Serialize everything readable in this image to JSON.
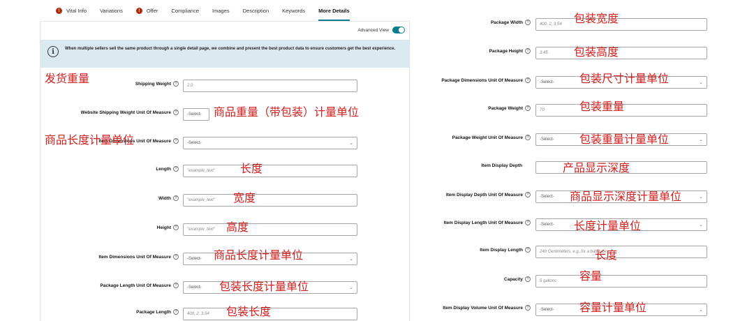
{
  "tabs": [
    {
      "label": "Vital Info",
      "error": true
    },
    {
      "label": "Variations",
      "error": false
    },
    {
      "label": "Offer",
      "error": true
    },
    {
      "label": "Compliance",
      "error": false
    },
    {
      "label": "Images",
      "error": false
    },
    {
      "label": "Description",
      "error": false
    },
    {
      "label": "Keywords",
      "error": false
    },
    {
      "label": "More Details",
      "error": false,
      "active": true
    }
  ],
  "error_badge": "!",
  "advanced_view": {
    "label": "Advanced View",
    "enabled": true
  },
  "info_banner": {
    "icon": "info-icon",
    "text": "When multiple sellers sell the same product through a single detail page, we combine and present the best product data to ensure customers get the best experience."
  },
  "help_glyph": "?",
  "left_fields": [
    {
      "label": "Shipping Weight",
      "placeholder": "2.0",
      "type": "input",
      "annotation": "商品重量(带包装)计量单位"
    },
    {
      "label": "Website Shipping Weight Unit Of Measure",
      "placeholder": "-Select-",
      "type": "select",
      "annotation": "商品重量（带包装）计量单位"
    },
    {
      "label": "Item Dimensions Unit Of Measure",
      "placeholder": "-Select-",
      "type": "select",
      "annotation": "商品长度计量单位"
    },
    {
      "label": "Length",
      "placeholder": "\"example_text\"",
      "type": "input",
      "annotation": "长度"
    },
    {
      "label": "Width",
      "placeholder": "\"example_text\"",
      "type": "input",
      "annotation": "宽度"
    },
    {
      "label": "Height",
      "placeholder": "\"example_text\"",
      "type": "input",
      "annotation": "高度"
    },
    {
      "label": "Item Dimensions Unit Of Measure",
      "placeholder": "-Select-",
      "type": "select",
      "annotation": "商品长度计量单位"
    },
    {
      "label": "Package Length Unit Of Measure",
      "placeholder": "-Select-",
      "type": "select",
      "annotation": "包装长度计量单位"
    },
    {
      "label": "Package Length",
      "placeholder": "400, 2, 3.54",
      "type": "input",
      "annotation": "包装长度"
    }
  ],
  "left_side_annotations": {
    "shipping_weight": "发货重量",
    "item_length_unit": "商品长度计量单位"
  },
  "right_fields": [
    {
      "label": "Package Width",
      "placeholder": "400, 2, 3.54",
      "type": "input",
      "help": true,
      "annotation": "包装宽度"
    },
    {
      "label": "Package Height",
      "placeholder": "3.45",
      "type": "input",
      "help": true,
      "annotation": "包装高度"
    },
    {
      "label": "Package Dimensions Unit Of Measure",
      "placeholder": "-Select-",
      "type": "select",
      "help": true,
      "annotation": "包装尺寸计量单位"
    },
    {
      "label": "Package Weight",
      "placeholder": "70",
      "type": "input",
      "help": true,
      "annotation": "包装重量"
    },
    {
      "label": "Package Weight Unit Of Measure",
      "placeholder": "-Select-",
      "type": "select",
      "help": true,
      "annotation": "包装重量计量单位"
    },
    {
      "label": "Item Display Depth",
      "placeholder": "",
      "type": "input",
      "help": false,
      "annotation": "产品显示深度"
    },
    {
      "label": "Item Display Depth Unit Of Measure",
      "placeholder": "-Select-",
      "type": "select",
      "help": true,
      "annotation": "商品显示深度计量单位"
    },
    {
      "label": "Item Display Length Unit Of Measure",
      "placeholder": "-Select-",
      "type": "select",
      "help": true,
      "annotation": "长度计量单位"
    },
    {
      "label": "Item Display Length",
      "placeholder": "240 Centimeters, e.g. for a bathtube",
      "type": "input",
      "help": true,
      "annotation": "长度"
    },
    {
      "label": "Capacity",
      "placeholder": "5 gallons",
      "type": "input",
      "help": true,
      "annotation": "容量"
    },
    {
      "label": "Item Display Volume Unit Of Measure",
      "placeholder": "-Select-",
      "type": "select",
      "help": true,
      "annotation": "容量计量单位"
    }
  ],
  "colors": {
    "accent": "#0a7e8c",
    "error": "#b12704",
    "annotation": "#d0201f",
    "banner": "#dbeaf0"
  }
}
